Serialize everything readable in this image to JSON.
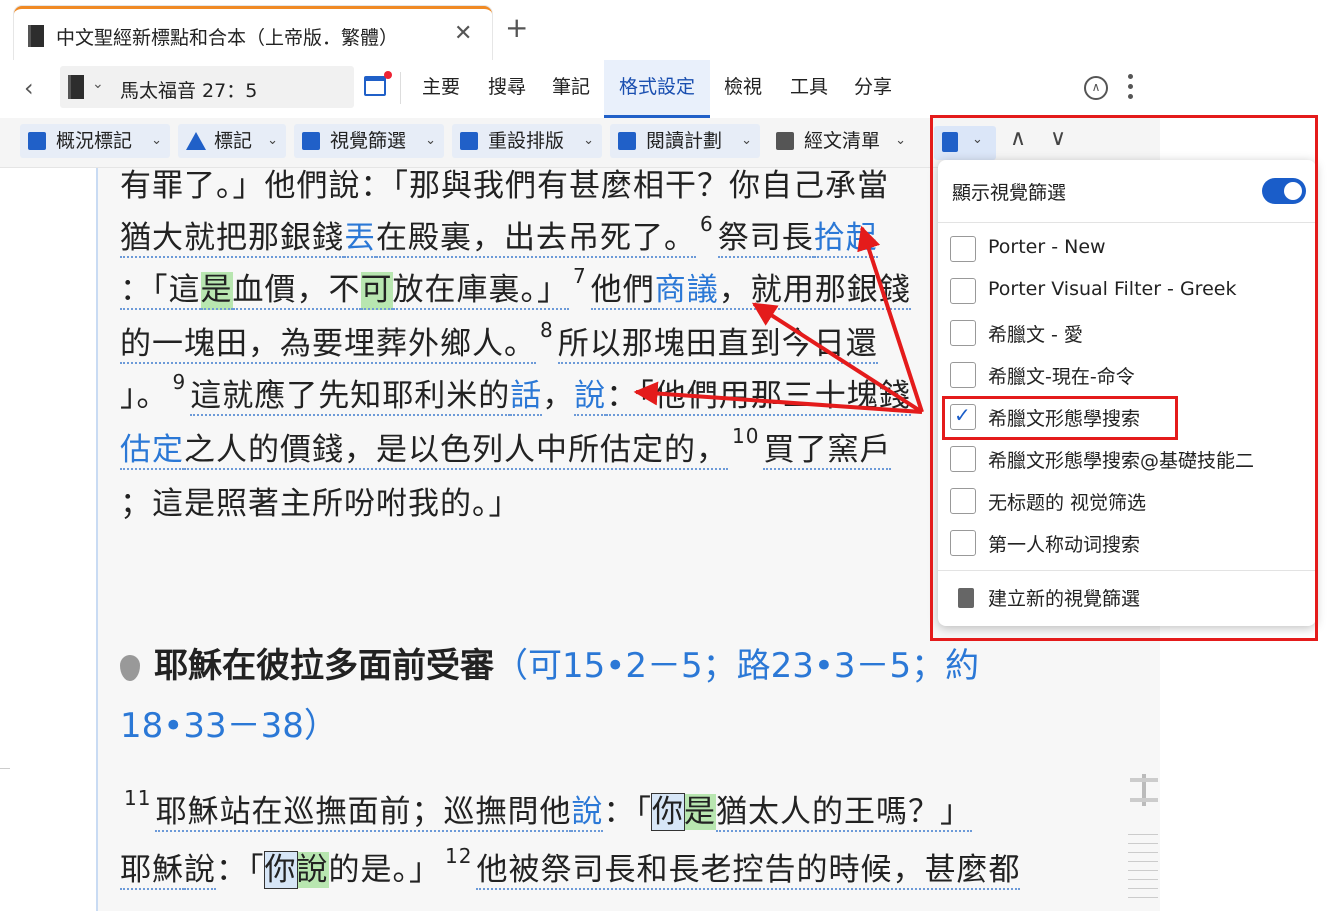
{
  "tab": {
    "title": "中文聖經新標點和合本（上帝版．繁體）",
    "close": "✕",
    "new": "+"
  },
  "nav": {
    "back": "‹",
    "reference": "馬太福音 27：5",
    "menus": [
      "主要",
      "搜尋",
      "筆記",
      "格式設定",
      "檢視",
      "工具",
      "分享"
    ],
    "active_menu": "格式設定"
  },
  "toolbar": {
    "buttons": [
      "概況標記",
      "標記",
      "視覺篩選",
      "重設排版",
      "閱讀計劃",
      "經文清單"
    ]
  },
  "text": {
    "line1": "有罪了。」他們說：「那與我們有甚麼相干？你自己承當",
    "line2_a": "猶大就把那銀錢",
    "line2_b": "丟",
    "line2_c": "在殿裏，出去吊死了。",
    "line2_v": "6",
    "line2_d": "祭司長",
    "line2_e": "拾起",
    "line3_a": "：「這",
    "line3_b": "是",
    "line3_c": "血價，不",
    "line3_d": "可",
    "line3_e": "放在庫裏。」",
    "line3_v": "7",
    "line3_f": "他們",
    "line3_g": "商議",
    "line3_h": "，就用那銀錢",
    "line4_a": "的一塊田，為要埋葬外鄉人。",
    "line4_v": "8",
    "line4_b": "所以那塊田直到今日還",
    "line5_a": "」。",
    "line5_v": "9",
    "line5_b": "這就應了先知耶利米的",
    "line5_c": "話",
    "line5_d": "，",
    "line5_e": "說",
    "line5_f": "：「他們用那三十塊錢",
    "line6_a": "估定",
    "line6_b": "之人的價錢，是以色列人中所估定的，",
    "line6_v": "10",
    "line6_c": "買了窯戶",
    "line7": "；這是照著主所吩咐我的。」",
    "heading": "耶穌在彼拉多面前受審",
    "heading_ref1": "（可15•2－5；路23•3－5；約",
    "heading_ref2": "18•33－38）",
    "line8_v": "11",
    "line8_a": "耶穌站在巡撫面前；巡撫問他",
    "line8_b": "說",
    "line8_c": "：「",
    "line8_d": "你",
    "line8_e": "是",
    "line8_f": "猶太人的王嗎？」",
    "line9_a": "耶穌",
    "line9_b": "說",
    "line9_c": "：「",
    "line9_d": "你",
    "line9_e": "說",
    "line9_f": "的是。」",
    "line9_v": "12",
    "line9_g": "他被祭司長和長老控告的時候，甚麼都"
  },
  "panel": {
    "header": "顯示視覺篩選",
    "toggle_on": true,
    "filters": [
      {
        "label": "Porter - New",
        "checked": false
      },
      {
        "label": "Porter Visual Filter - Greek",
        "checked": false
      },
      {
        "label": "希臘文 - 愛",
        "checked": false
      },
      {
        "label": "希臘文-現在-命令",
        "checked": false
      },
      {
        "label": "希臘文形態學搜索",
        "checked": true
      },
      {
        "label": "希臘文形態學搜索@基礎技能二",
        "checked": false
      },
      {
        "label": "无标题的 视觉筛选",
        "checked": false
      },
      {
        "label": "第一人称动词搜索",
        "checked": false
      }
    ],
    "new_filter": "建立新的視覺篩選"
  },
  "colors": {
    "accent": "#2060c8",
    "annotation_red": "#e41b1b",
    "highlight_green": "#b8e6b0",
    "word_blue": "#2b78d6"
  }
}
